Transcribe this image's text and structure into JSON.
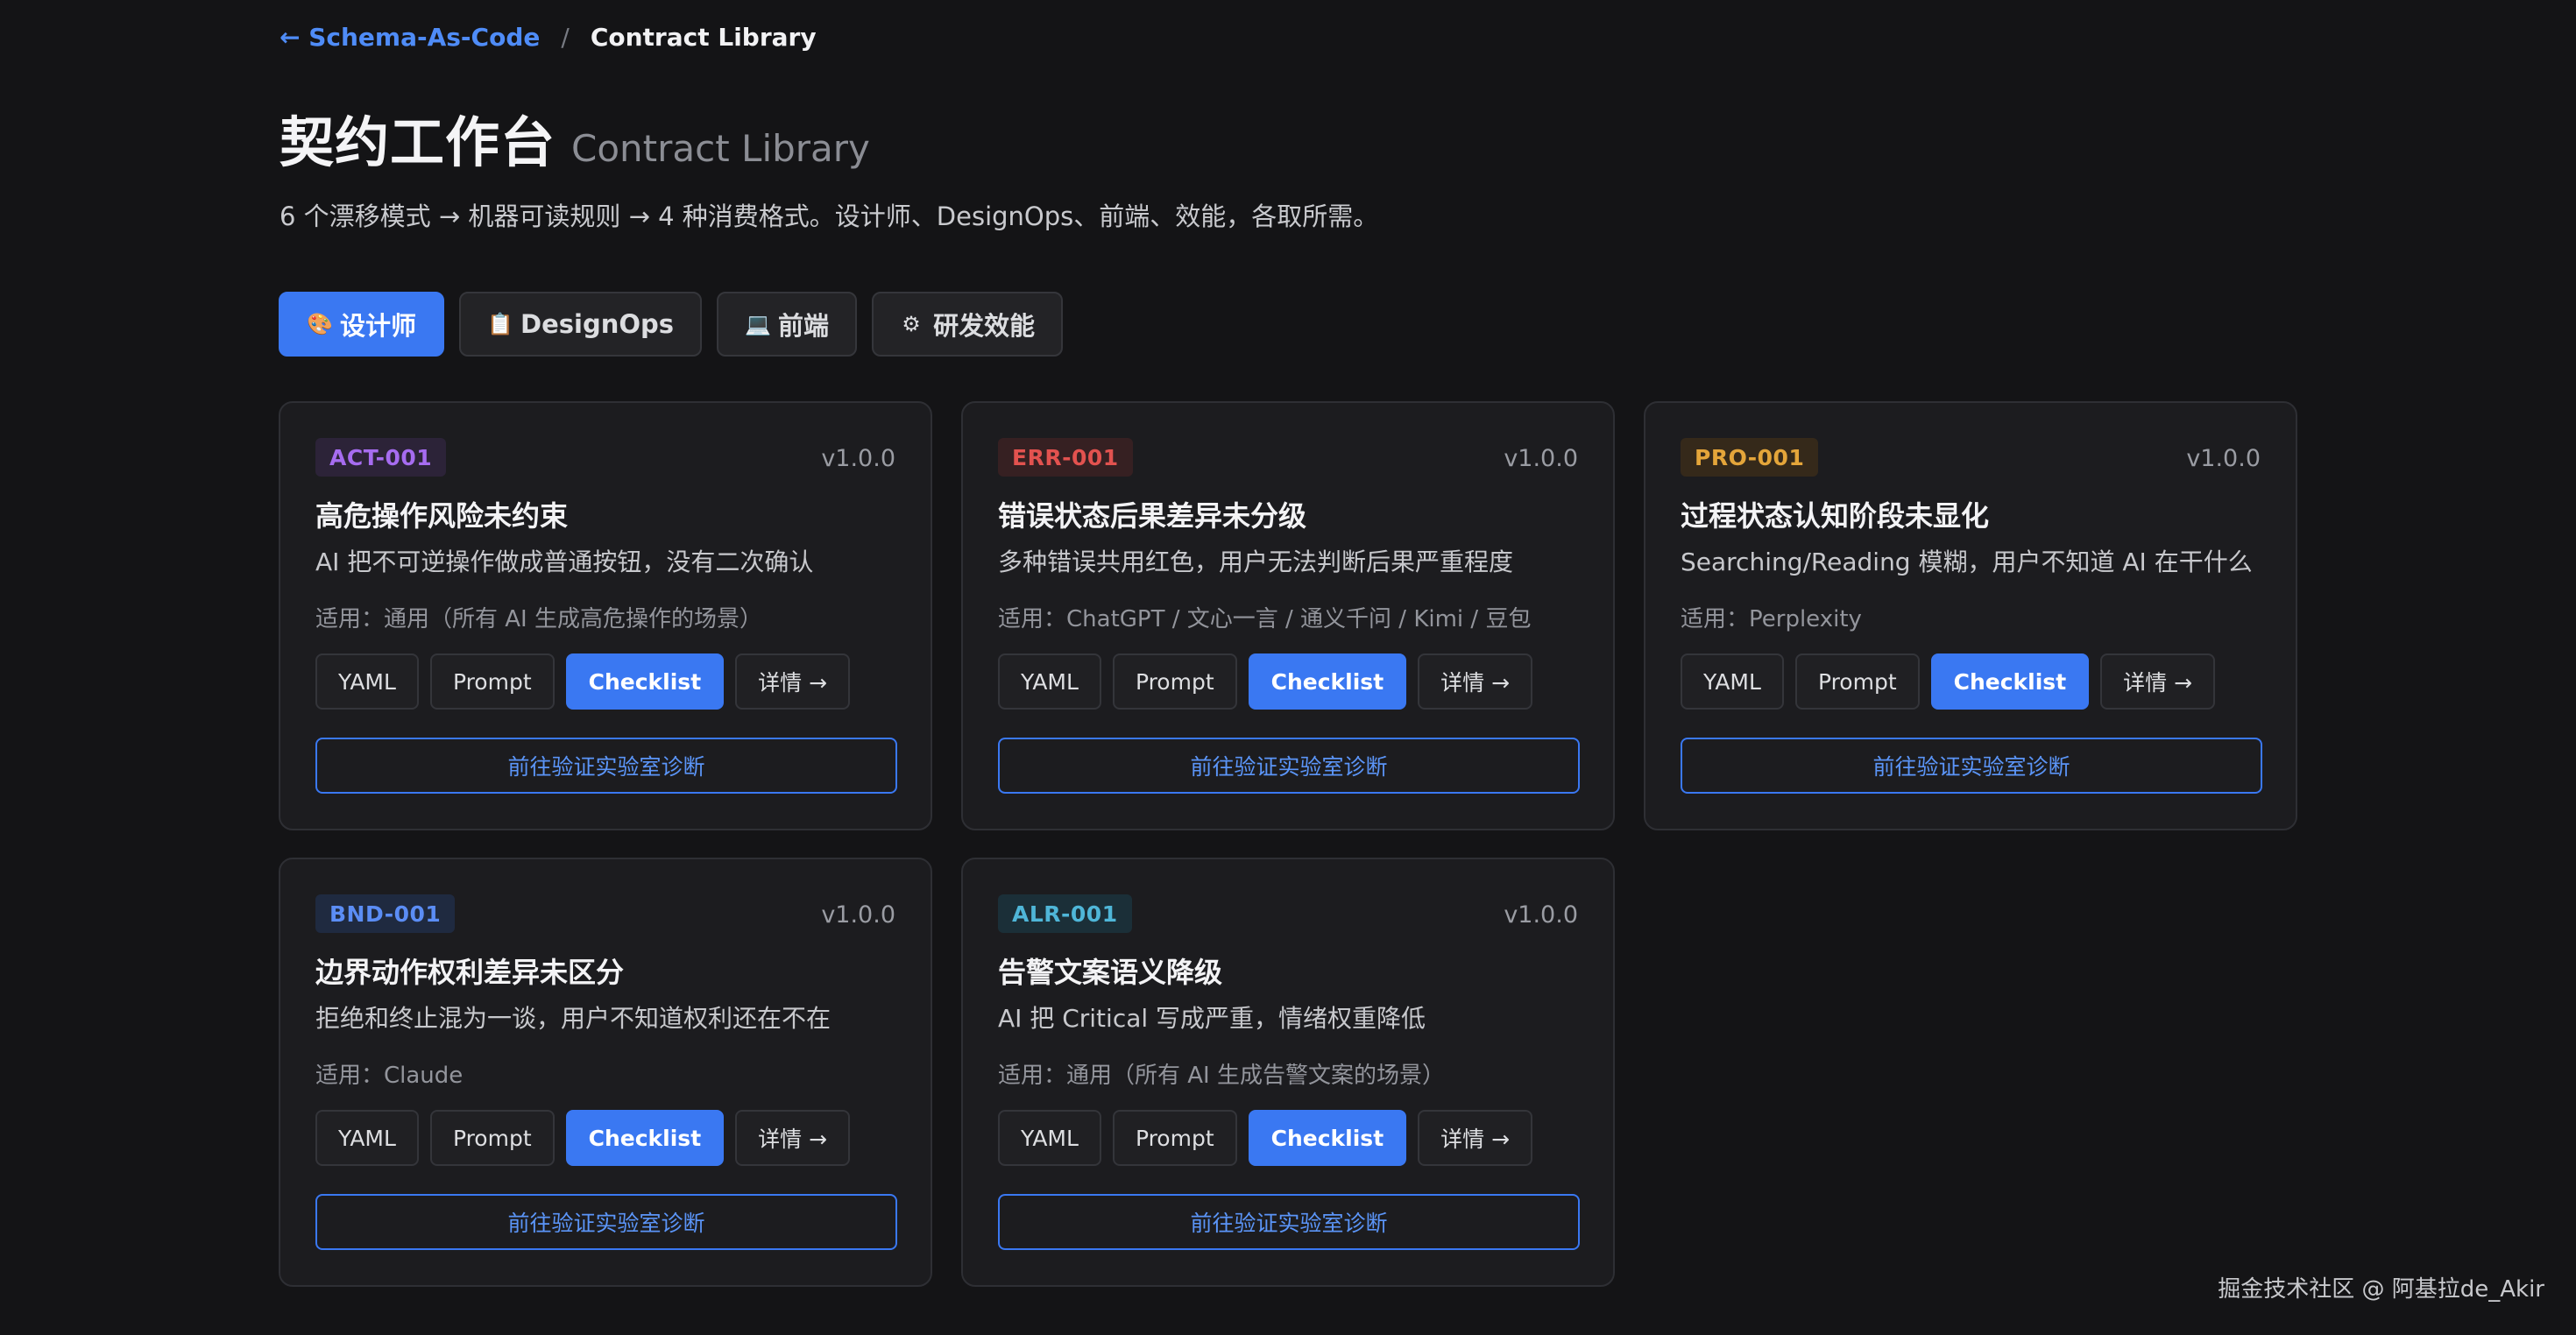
{
  "breadcrumb": {
    "back_label": "← Schema-As-Code",
    "separator": "/",
    "current": "Contract Library"
  },
  "header": {
    "title": "契约工作台",
    "title_en": "Contract Library",
    "subtitle": "6 个漂移模式 → 机器可读规则 → 4 种消费格式。设计师、DesignOps、前端、效能，各取所需。"
  },
  "tabs": [
    {
      "icon": "🎨",
      "icon_name": "palette-icon",
      "label": "设计师",
      "active": true
    },
    {
      "icon": "📋",
      "icon_name": "clipboard-icon",
      "label": "DesignOps",
      "active": false
    },
    {
      "icon": "💻",
      "icon_name": "laptop-icon",
      "label": "前端",
      "active": false
    },
    {
      "icon": "⚙",
      "icon_name": "gear-icon",
      "label": "研发效能",
      "active": false
    }
  ],
  "button_labels": {
    "yaml": "YAML",
    "prompt": "Prompt",
    "checklist": "Checklist",
    "detail": "详情 →",
    "cta": "前往验证实验室诊断"
  },
  "cards": [
    {
      "id": "ACT-001",
      "id_color": "#a66cf0",
      "id_bg": "#2c2338",
      "version": "v1.0.0",
      "title": "高危操作风险未约束",
      "desc": "AI 把不可逆操作做成普通按钮，没有二次确认",
      "scope": "适用：通用（所有 AI 生成高危操作的场景）"
    },
    {
      "id": "ERR-001",
      "id_color": "#e2524f",
      "id_bg": "#362022",
      "version": "v1.0.0",
      "title": "错误状态后果差异未分级",
      "desc": "多种错误共用红色，用户无法判断后果严重程度",
      "scope": "适用：ChatGPT / 文心一言 / 通义千问 / Kimi / 豆包"
    },
    {
      "id": "PRO-001",
      "id_color": "#e4a53a",
      "id_bg": "#35291a",
      "version": "v1.0.0",
      "title": "过程状态认知阶段未显化",
      "desc": "Searching/Reading 模糊，用户不知道 AI 在干什么",
      "scope": "适用：Perplexity"
    },
    {
      "id": "BND-001",
      "id_color": "#5b8df5",
      "id_bg": "#1f2a40",
      "version": "v1.0.0",
      "title": "边界动作权利差异未区分",
      "desc": "拒绝和终止混为一谈，用户不知道权利还在不在",
      "scope": "适用：Claude"
    },
    {
      "id": "ALR-001",
      "id_color": "#4fb6d8",
      "id_bg": "#1b2f38",
      "version": "v1.0.0",
      "title": "告警文案语义降级",
      "desc": "AI 把 Critical 写成严重，情绪权重降低",
      "scope": "适用：通用（所有 AI 生成告警文案的场景）"
    }
  ],
  "watermark": "掘金技术社区 @ 阿基拉de_Akir"
}
